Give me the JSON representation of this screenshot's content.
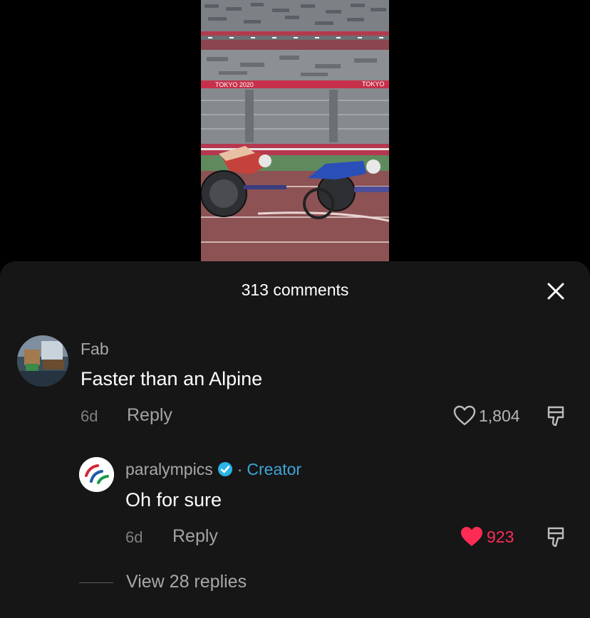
{
  "video": {
    "banner_left": "TOKYO 2020",
    "banner_right": "TOKYO"
  },
  "sheet": {
    "title": "313 comments"
  },
  "comments": [
    {
      "username": "Fab",
      "text": "Faster than an Alpine",
      "age": "6d",
      "reply_label": "Reply",
      "likes": "1,804",
      "liked": false
    }
  ],
  "reply": {
    "username": "paralympics",
    "separator": "·",
    "creator_label": "Creator",
    "text": "Oh for sure",
    "age": "6d",
    "reply_label": "Reply",
    "likes": "923",
    "liked": true
  },
  "view_replies_label": "View 28 replies",
  "colors": {
    "liked": "#fe2c55",
    "creator": "#3fa3d8",
    "sheet_bg": "#161616"
  },
  "icons": [
    "close-icon",
    "heart-outline-icon",
    "heart-filled-icon",
    "dislike-icon",
    "verified-icon"
  ]
}
